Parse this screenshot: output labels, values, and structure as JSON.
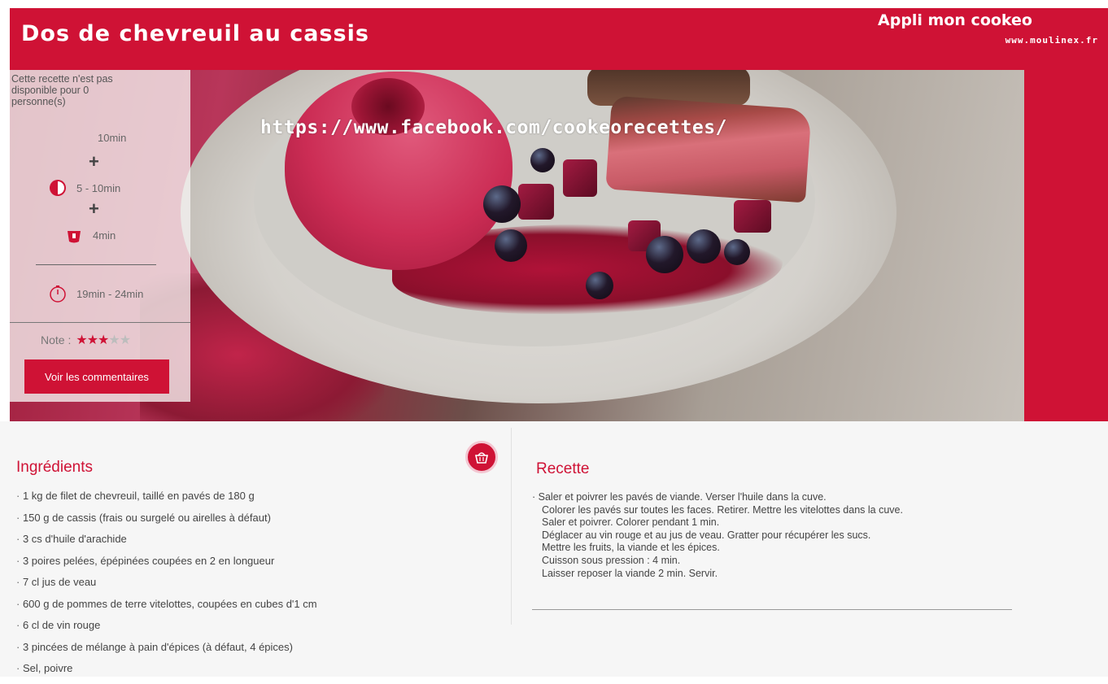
{
  "header": {
    "title": "Dos de chevreuil au cassis",
    "app_name": "Appli mon cookeo",
    "app_url": "www.moulinex.fr"
  },
  "hero": {
    "overlay_url": "https://www.facebook.com/cookeorecettes/"
  },
  "info": {
    "availability": "Cette recette n'est pas disponible pour 0 personne(s)",
    "prep_time": "10min",
    "plus": "+",
    "cook_time": "5 - 10min",
    "pressure_time": "4min",
    "total_time": "19min - 24min",
    "rating_label": "Note :",
    "rating_value": 3,
    "rating_max": 5,
    "comments_button": "Voir les commentaires"
  },
  "ingredients": {
    "title": "Ingrédients",
    "items": [
      "1 kg de filet de chevreuil, taillé en pavés de 180 g",
      "150 g de cassis (frais ou surgelé ou airelles à défaut)",
      "3 cs d'huile d'arachide",
      "3 poires pelées, épépinées coupées en 2 en longueur",
      "7 cl jus de veau",
      "600 g de pommes de terre vitelottes, coupées en cubes d'1 cm",
      "6 cl de vin rouge",
      "3 pincées de mélange à pain d'épices (à défaut, 4 épices)",
      "Sel, poivre"
    ]
  },
  "recipe": {
    "title": "Recette",
    "lines": [
      "Saler et poivrer les pavés de viande. Verser l'huile dans la cuve.",
      "Colorer les pavés sur toutes les faces. Retirer. Mettre les vitelottes dans la cuve.",
      "Saler et poivrer. Colorer pendant 1 min.",
      "Déglacer au vin rouge et au jus de veau. Gratter pour récupérer les sucs.",
      "Mettre les fruits, la viande et les épices.",
      "Cuisson sous pression : 4 min.",
      "Laisser reposer la viande 2 min. Servir."
    ]
  },
  "colors": {
    "brand": "#cf1235",
    "star_off": "#bdbdbd"
  },
  "icons": [
    "cooking-pot-icon",
    "pressure-cooker-icon",
    "timer-icon",
    "basket-icon",
    "star-icon"
  ]
}
